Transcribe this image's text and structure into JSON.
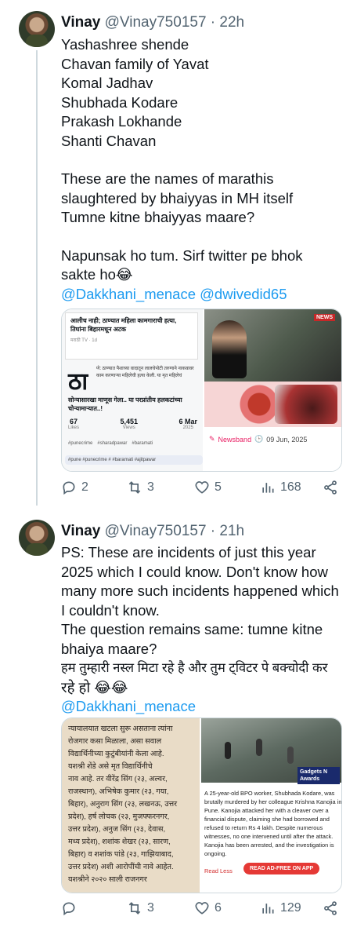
{
  "tweet1": {
    "name": "Vinay",
    "handle": "@Vinay750157",
    "time": "· 22h",
    "lines": [
      "Yashashree shende",
      "Chavan family of Yavat",
      "Komal Jadhav",
      "Shubhada Kodare",
      "Prakash Lokhande",
      "Shanti Chavan",
      "",
      "These are the names of marathis",
      "slaughtered by bhaiyyas in MH itself",
      "Tumne kitne bhaiyyas maare?",
      "",
      "Napunsak ho tum. Sirf twitter pe bhok",
      "sakte ho😂"
    ],
    "mentions": [
      "@Dakkhani_menace",
      "@dwivedid65"
    ],
    "media_left": {
      "headline_marathi": "आलीच नाही; ठाण्यात महिला कामगाराची हत्या, तिघांना बिहारमधून अटक",
      "source": "मराठी TV · 1d",
      "big_letter": "ठा",
      "snippet": "णे: ठाण्यात पैशाच्या वादातून लालचेपोटी तरुणाने नाकवावर काम करणाऱ्या महिलेची हत्या केली. या मृत महिलेचं",
      "sub_headline": "सोन्यासारखा माणूस गेला.. या परप्रांतीय हलकटांच्या चोऱ्यामाऱ्यात..!",
      "stats": [
        {
          "value": "67",
          "label": "Likes"
        },
        {
          "value": "5,451",
          "label": "Views"
        },
        {
          "value": "6 Mar",
          "label": "2025"
        }
      ],
      "tags": [
        "#punecrime",
        "#sharadpawar",
        "#baramati"
      ],
      "tags2": "#pune #punecrime # #baramati #ajitpawar"
    },
    "media_right": {
      "badge": "NEWS",
      "source": "Newsband",
      "date": "09 Jun, 2025"
    },
    "actions": {
      "replies": "2",
      "retweets": "3",
      "likes": "5",
      "views": "168"
    }
  },
  "tweet2": {
    "name": "Vinay",
    "handle": "@Vinay750157",
    "time": "· 21h",
    "lines": [
      "PS: These are incidents of just this year",
      "2025 which I could know. Don't know how",
      "many more such incidents happened which",
      "I couldn't know.",
      "The question remains same: tumne kitne",
      "bhaiya maare?",
      "हम तुम्हारी नस्ल मिटा रहे है और तुम ट्विटर पे बक्चोदी कर",
      "रहे हो 😂😂"
    ],
    "mentions": [
      "@Dakkhani_menace"
    ],
    "media_left": {
      "newspaper_lines": [
        "न्यायालयात खटला सुरू असताना त्यांना",
        "रोजगार कसा मिळाला, असा सवाल",
        "विद्यार्थिनीच्या कुटुंबीयांनी केला आहे.",
        "यशश्री शेंडे असे मृत विद्यार्थिनीचे",
        "नाव आहे. तर वीरेंद्र सिंग (२३, अल्वर,",
        "राजस्थान), अभिषेक कुमार (२३, गया,",
        "बिहार), अनुराग सिंग (२३, लखनऊ, उत्तर",
        "प्रदेश), हर्ष लोचक (२३, मुजफ्फरनगर,",
        "उत्तर प्रदेश), अनुज सिंग (२३, देवास,",
        "मध्य प्रदेश), शशांक शेखर (२३, सारण,",
        "बिहार) व शशांक पांडे (२३, गाझियाबाद,",
        "उत्तर प्रदेश) अशी आरोपींची नावे आहेत.",
        "यशश्रीने २०२० साली राजनगर"
      ]
    },
    "media_right": {
      "badge": "Gadgets N Awards",
      "article_lines": [
        "A 25-year-old BPO worker, Shubhada Kodare, was",
        "brutally murdered by her colleague Krishna Kanojia in",
        "Pune. Kanojia attacked her with a cleaver over a",
        "financial dispute, claiming she had borrowed and",
        "refused to return Rs 4 lakh. Despite numerous",
        "witnesses, no one intervened until after the attack.",
        "Kanojia has been arrested, and the investigation is",
        "ongoing."
      ],
      "read_less": "Read Less",
      "cta": "READ AD-FREE ON APP"
    },
    "actions": {
      "replies": "",
      "retweets": "3",
      "likes": "6",
      "views": "129"
    }
  },
  "colors": {
    "link": "#1d9bf0",
    "muted": "#536471",
    "text": "#0f1419",
    "border": "#cfd9de"
  }
}
